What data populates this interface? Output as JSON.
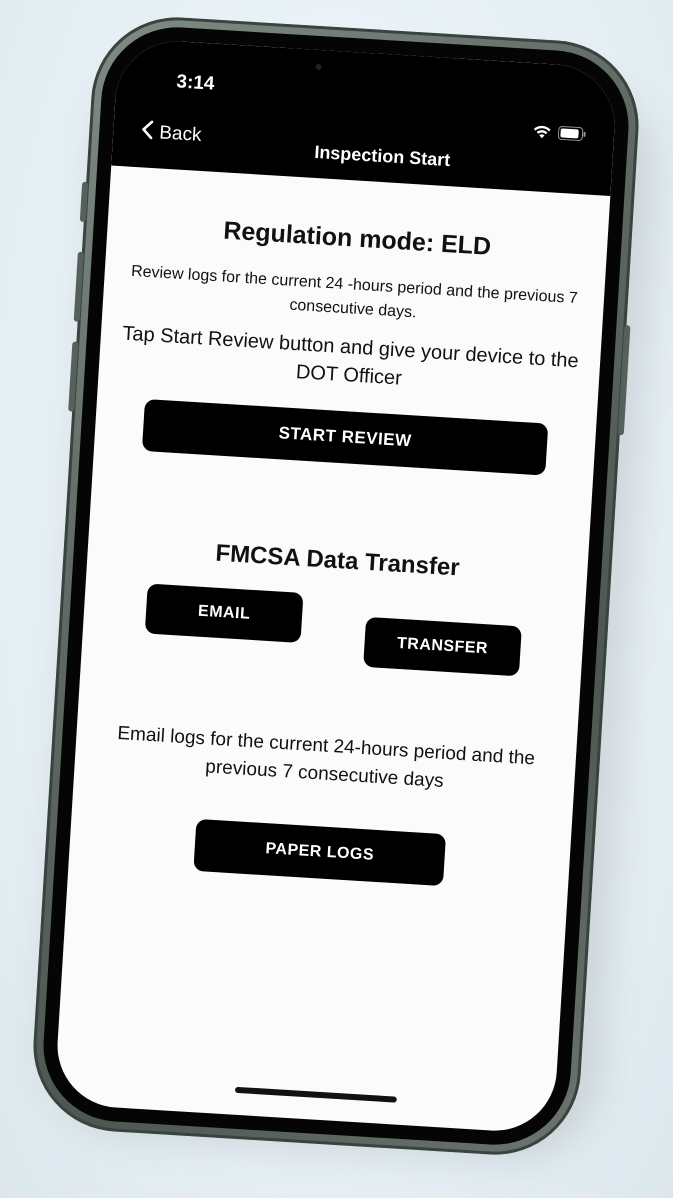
{
  "status_bar": {
    "time": "3:14"
  },
  "nav": {
    "back_label": "Back",
    "title": "Inspection Start"
  },
  "regulation": {
    "heading": "Regulation mode: ELD",
    "review_text": "Review logs for the current 24 -hours period and the previous 7 consecutive days.",
    "instruction_text": "Tap Start Review button and give your device to the DOT Officer",
    "start_button": "START REVIEW"
  },
  "transfer": {
    "heading": "FMCSA Data Transfer",
    "email_button": "EMAIL",
    "transfer_button": "TRANSFER"
  },
  "paper": {
    "email_text": "Email logs for the current 24-hours period and the previous 7 consecutive days",
    "paper_button": "PAPER LOGS"
  },
  "icons": {
    "back": "chevron-left-icon",
    "wifi": "wifi-icon",
    "battery": "battery-icon"
  },
  "colors": {
    "phone_frame": "#5f6b64",
    "button": "#000000",
    "background": "#e8f1f5"
  }
}
